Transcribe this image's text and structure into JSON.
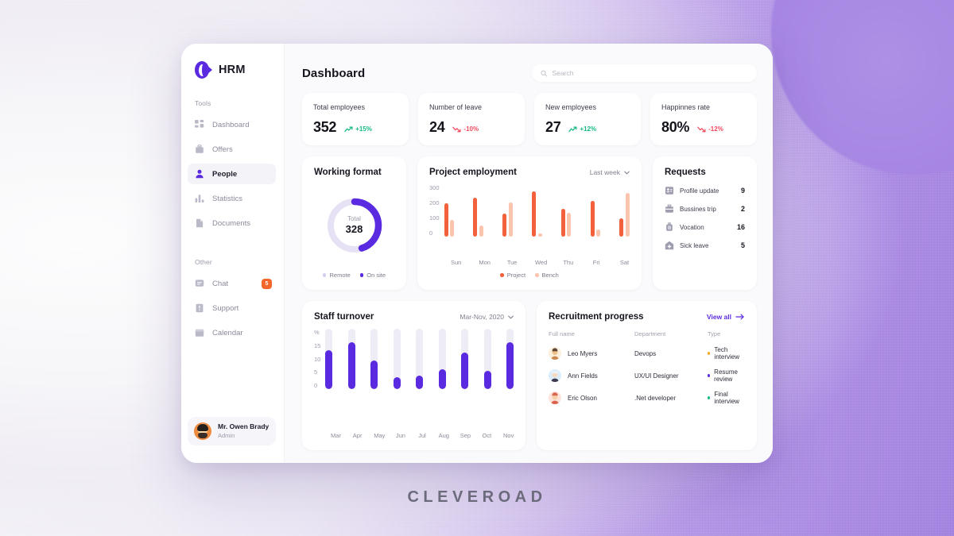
{
  "brand_wordmark": "CLEVEROAD",
  "app": {
    "logo_text": "HRM"
  },
  "sidebar": {
    "group_tools_label": "Tools",
    "group_other_label": "Other",
    "tools": [
      {
        "label": "Dashboard",
        "icon": "grid-icon",
        "active": false
      },
      {
        "label": "Offers",
        "icon": "briefcase-icon",
        "active": false
      },
      {
        "label": "People",
        "icon": "person-icon",
        "active": true
      },
      {
        "label": "Statistics",
        "icon": "bar-chart-icon",
        "active": false
      },
      {
        "label": "Documents",
        "icon": "document-icon",
        "active": false
      }
    ],
    "other": [
      {
        "label": "Chat",
        "icon": "chat-icon",
        "badge": "5"
      },
      {
        "label": "Support",
        "icon": "support-icon",
        "badge": ""
      },
      {
        "label": "Calendar",
        "icon": "calendar-icon",
        "badge": ""
      }
    ],
    "profile": {
      "name": "Mr. Owen Brady",
      "role": "Admin"
    }
  },
  "header": {
    "title": "Dashboard",
    "search_placeholder": "Search",
    "search_value": ""
  },
  "stats": [
    {
      "label": "Total employees",
      "value": "352",
      "delta": "+15%",
      "dir": "up"
    },
    {
      "label": "Number of leave",
      "value": "24",
      "delta": "-10%",
      "dir": "down"
    },
    {
      "label": "New employees",
      "value": "27",
      "delta": "+12%",
      "dir": "up"
    },
    {
      "label": "Happinnes rate",
      "value": "80%",
      "delta": "-12%",
      "dir": "down"
    }
  ],
  "working_format": {
    "title": "Working format",
    "total_label": "Total",
    "total_value": "328",
    "legend": [
      {
        "label": "Remote",
        "color": "#d8cff2"
      },
      {
        "label": "On site",
        "color": "#5a2ae0"
      }
    ]
  },
  "requests": {
    "title": "Requests",
    "items": [
      {
        "label": "Profile update",
        "count": "9",
        "icon": "profile-card-icon"
      },
      {
        "label": "Bussines trip",
        "count": "2",
        "icon": "briefcase-icon"
      },
      {
        "label": "Vocation",
        "count": "16",
        "icon": "suitcase-icon"
      },
      {
        "label": "Sick leave",
        "count": "5",
        "icon": "home-plus-icon"
      }
    ]
  },
  "recruitment": {
    "title": "Recruitment progress",
    "view_all_label": "View all",
    "columns": [
      "Full name",
      "Department",
      "Type"
    ],
    "rows": [
      {
        "name": "Leo Myers",
        "department": "Devops",
        "type": "Tech interview",
        "type_color": "#f5a623"
      },
      {
        "name": "Ann Fields",
        "department": "UX/UI Designer",
        "type": "Resume review",
        "type_color": "#5a2ae0"
      },
      {
        "name": "Eric Olson",
        "department": ".Net developer",
        "type": "Final interview",
        "type_color": "#12b886"
      }
    ]
  },
  "chart_data": [
    {
      "type": "bar",
      "title": "Project employment",
      "range_label": "Last week",
      "categories": [
        "Sun",
        "Mon",
        "Tue",
        "Wed",
        "Thu",
        "Fri",
        "Sat"
      ],
      "series": [
        {
          "name": "Project",
          "color": "#f2603c",
          "values": [
            190,
            225,
            130,
            260,
            160,
            205,
            105
          ]
        },
        {
          "name": "Bench",
          "color": "#fbc4ad",
          "values": [
            95,
            65,
            195,
            20,
            135,
            40,
            250
          ]
        }
      ],
      "ylabel": "",
      "xlabel": "",
      "yticks": [
        "300",
        "200",
        "100",
        "0"
      ],
      "ylim": [
        0,
        300
      ],
      "grid": false,
      "legend_position": "bottom"
    },
    {
      "type": "bar",
      "title": "Staff turnover",
      "range_label": "Mar-Nov, 2020",
      "categories": [
        "Mar",
        "Apr",
        "May",
        "Jun",
        "Jul",
        "Aug",
        "Sep",
        "Oct",
        "Nov"
      ],
      "series": [
        {
          "name": "Turnover",
          "color": "#5a2ae0",
          "values": [
            13,
            15.5,
            9.5,
            4,
            4.5,
            6.5,
            12,
            6,
            15.5
          ]
        }
      ],
      "ylabel": "%",
      "xlabel": "",
      "yticks": [
        "%",
        "15",
        "10",
        "5",
        "0"
      ],
      "ylim": [
        0,
        20
      ],
      "grid": false,
      "track_color": "#eeedf6",
      "legend_position": "none"
    },
    {
      "type": "pie",
      "title": "Working format",
      "labels": [
        "On site",
        "Remote"
      ],
      "values": [
        45,
        55
      ],
      "colors": [
        "#5a2ae0",
        "#e4ddf5"
      ],
      "center_label": "Total",
      "center_value": "328"
    }
  ]
}
